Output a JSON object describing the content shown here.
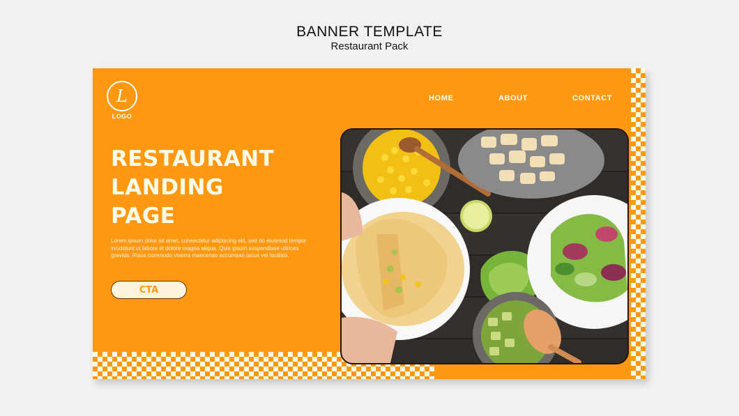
{
  "header": {
    "title": "BANNER TEMPLATE",
    "subtitle": "Restaurant Pack"
  },
  "banner": {
    "logo_letter": "L",
    "logo_label": "LOGO",
    "nav": [
      {
        "label": "HOME"
      },
      {
        "label": "ABOUT"
      },
      {
        "label": "CONTACT"
      }
    ],
    "headline": [
      "RESTAURANT",
      "LANDING",
      "PAGE"
    ],
    "body": "Lorem ipsum dolor sit amet, consectetur adipiscing elit, sed do eiusmod tempor incididunt ut labore et dolore magna aliqua. Quis ipsum suspendisse ultrices gravida. Risus commodo viverra maecenas accumsan lacus vel facilisis.",
    "cta_label": "CTA",
    "colors": {
      "brand_orange": "#ff9811",
      "cream": "#fffbe9",
      "dark_outline": "#2a1600"
    }
  },
  "photo": {
    "description_icon": "food-photo"
  }
}
